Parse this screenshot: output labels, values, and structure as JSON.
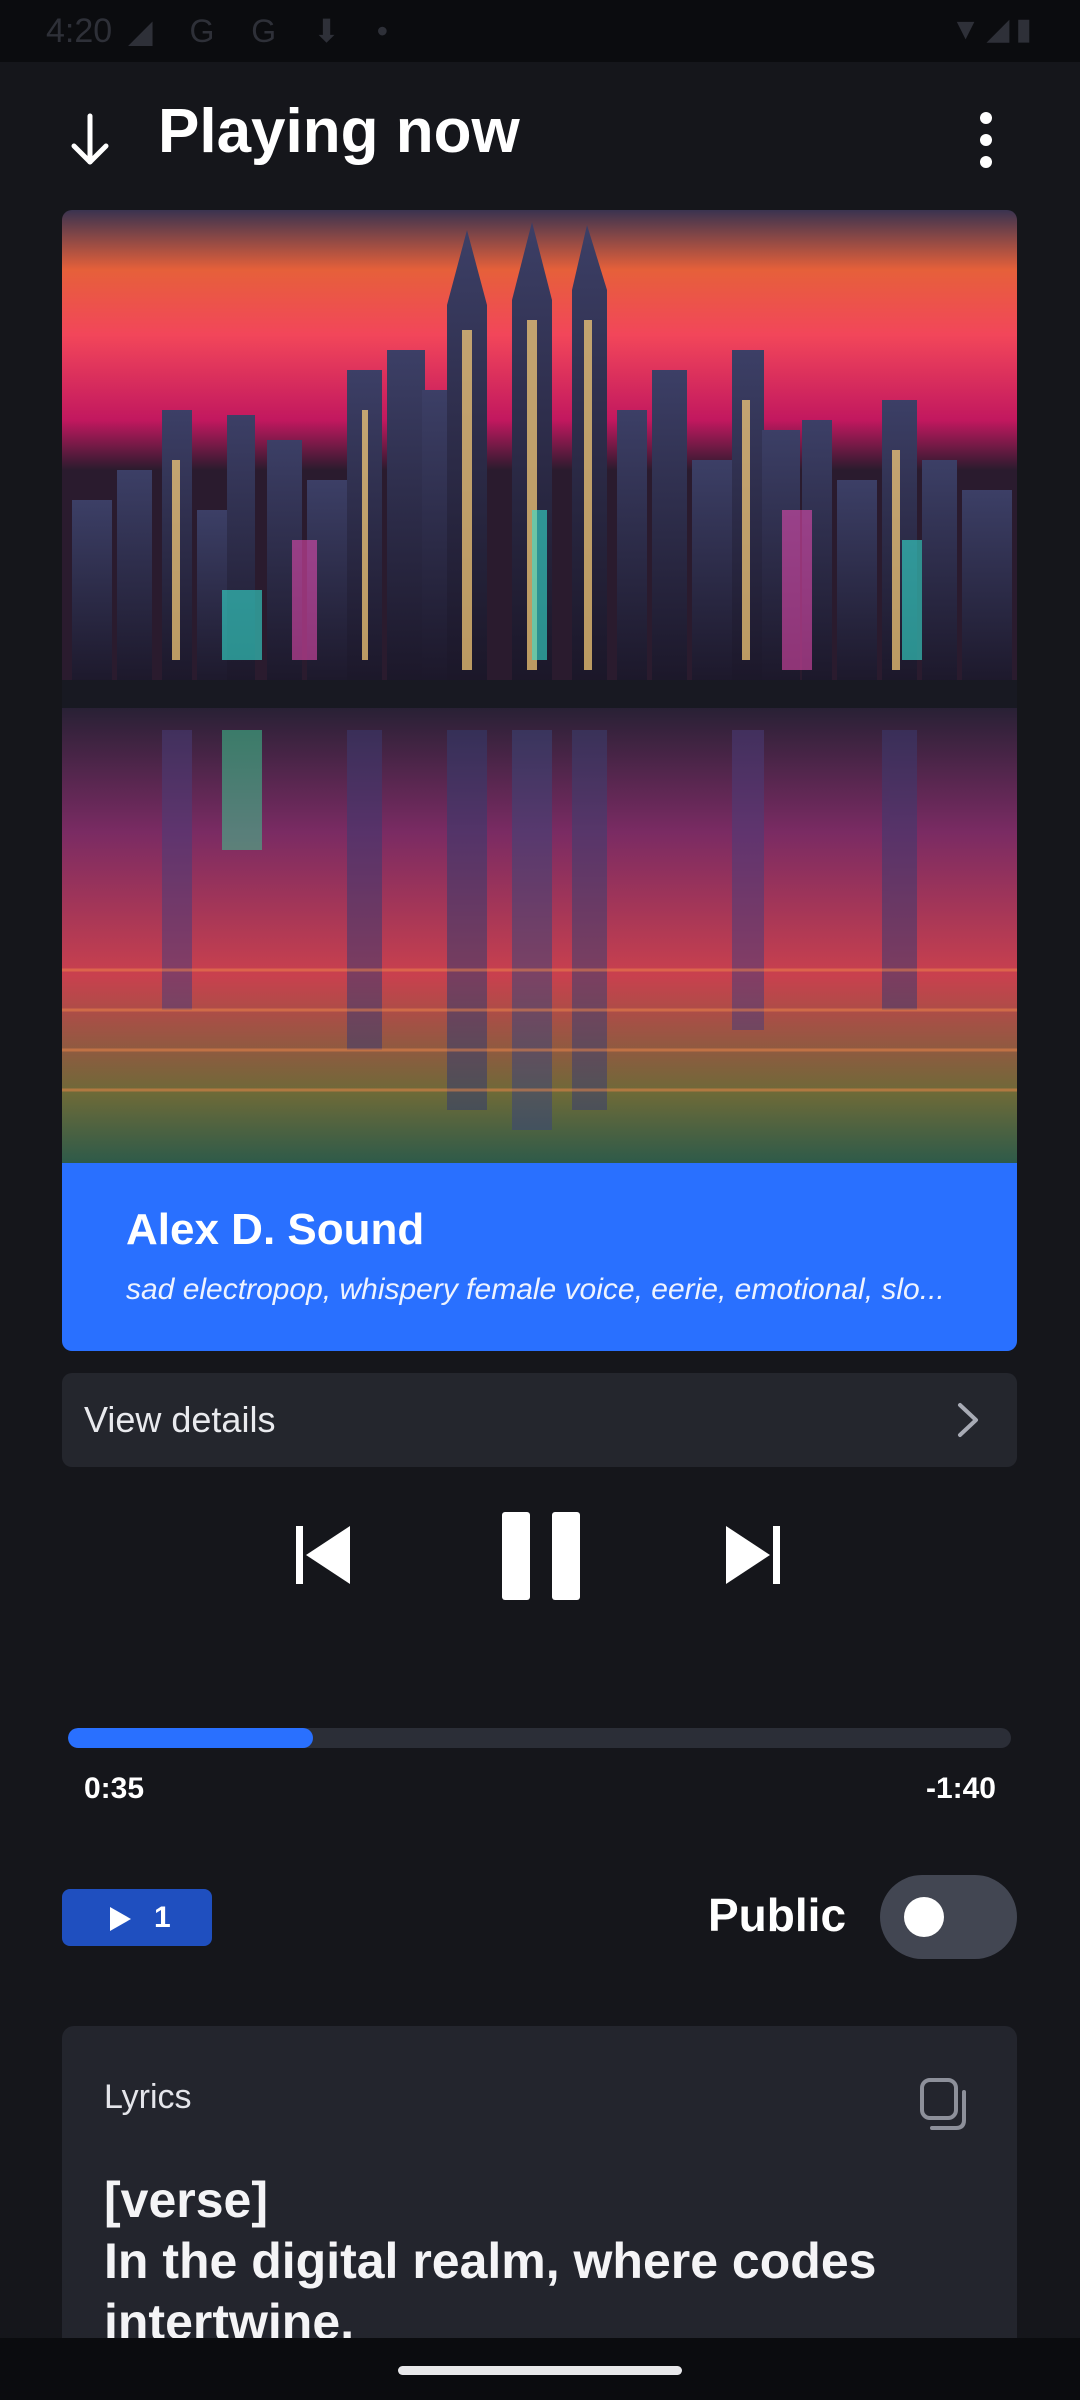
{
  "status_bar": {
    "time": "4:20",
    "left_icons": "◢ G G ⬇ •",
    "right_icons": "▼◢▮"
  },
  "header": {
    "title": "Playing now",
    "back_icon": "arrow-down-icon",
    "more_icon": "more-vertical-icon"
  },
  "song": {
    "artist": "Alex D. Sound",
    "tags": "sad electropop, whispery female voice, eerie, emotional, slo..."
  },
  "details": {
    "label": "View details",
    "icon": "chevron-right-icon"
  },
  "controls": {
    "prev_icon": "skip-previous-icon",
    "pause_icon": "pause-icon",
    "next_icon": "skip-next-icon"
  },
  "progress": {
    "elapsed": "0:35",
    "remaining": "-1:40",
    "fraction": 0.26
  },
  "stats": {
    "play_count": "1",
    "public_label": "Public",
    "public_on": false
  },
  "lyrics": {
    "title": "Lyrics",
    "text": "[verse]\nIn the digital realm, where codes intertwine,\nAlexey Dmitriev, a developer so fine"
  },
  "colors": {
    "accent": "#2970ff",
    "background": "#15161b",
    "card": "#23252d"
  }
}
